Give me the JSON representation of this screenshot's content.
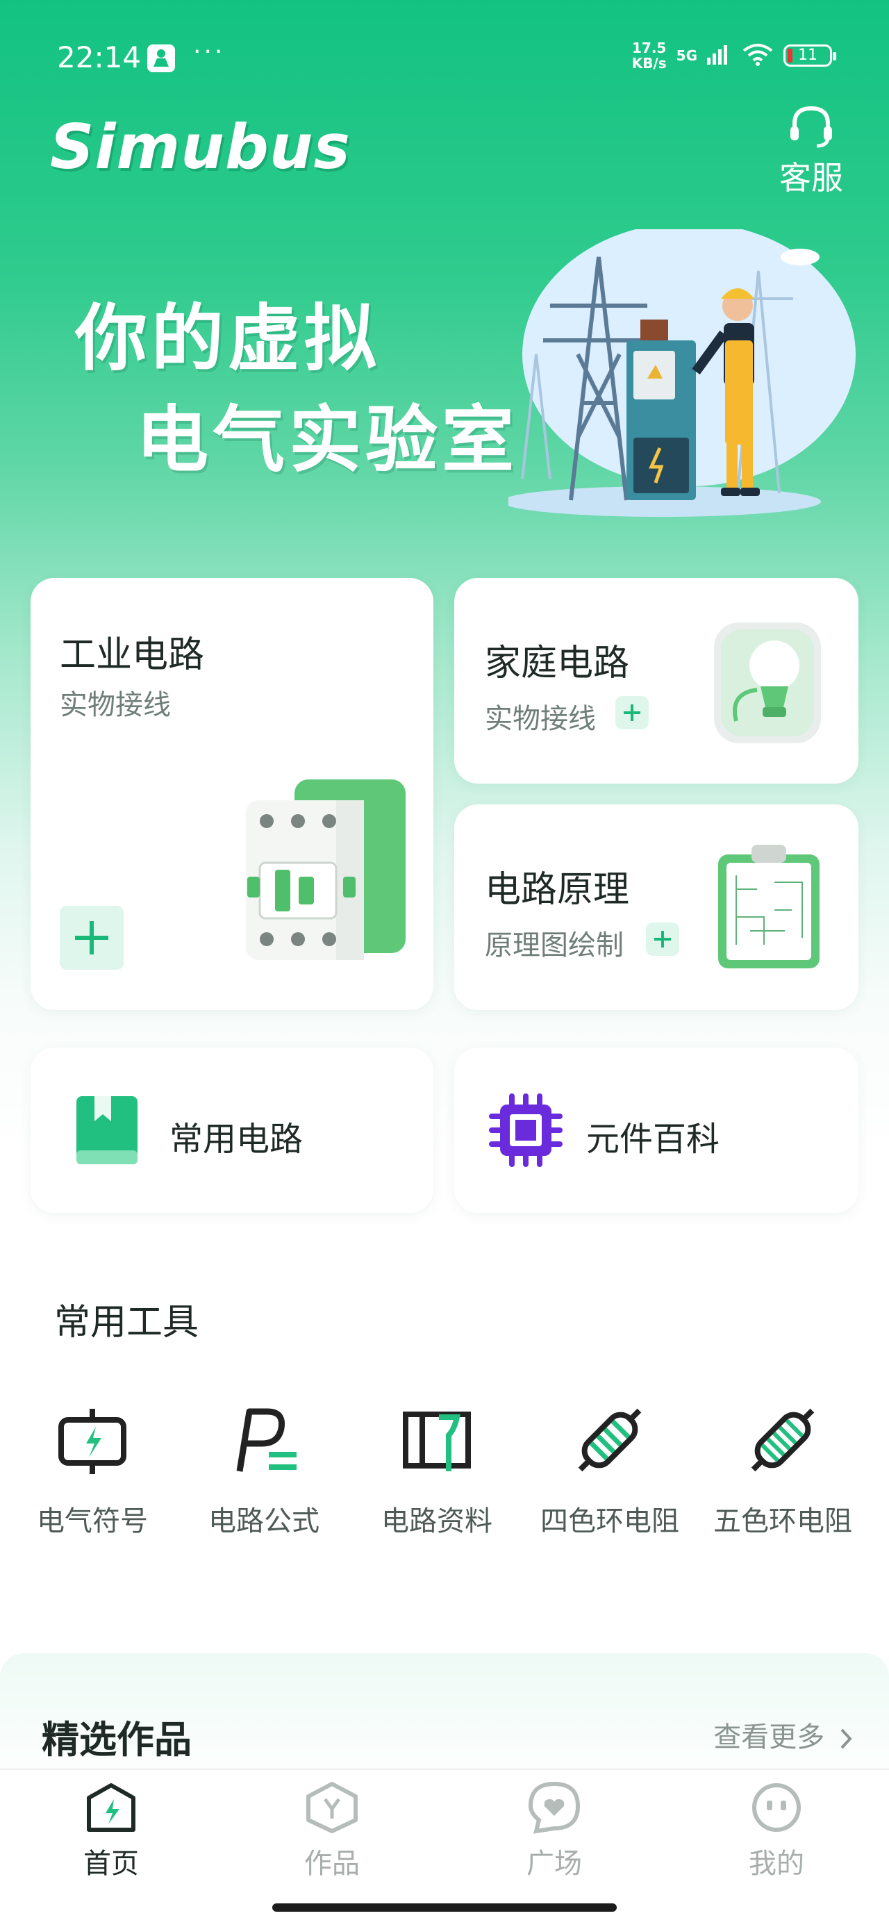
{
  "status_bar": {
    "time": "22:14",
    "dots": "···",
    "speed_top": "17.5",
    "speed_bottom": "KB/s",
    "network": "5G",
    "battery": "11"
  },
  "header": {
    "app_name": "Simubus",
    "service_label": "客服"
  },
  "hero": {
    "slogan_line1": "你的虚拟",
    "slogan_line2": "电气实验室"
  },
  "cards": {
    "industrial": {
      "title": "工业电路",
      "subtitle": "实物接线"
    },
    "home": {
      "title": "家庭电路",
      "subtitle": "实物接线"
    },
    "principle": {
      "title": "电路原理",
      "subtitle": "原理图绘制"
    },
    "common_circuits": {
      "title": "常用电路"
    },
    "components": {
      "title": "元件百科"
    }
  },
  "tools": {
    "title": "常用工具",
    "items": [
      {
        "label": "电气符号",
        "icon": "electric-symbol-icon"
      },
      {
        "label": "电路公式",
        "icon": "formula-icon"
      },
      {
        "label": "电路资料",
        "icon": "book-icon"
      },
      {
        "label": "四色环电阻",
        "icon": "resistor-icon"
      },
      {
        "label": "五色环电阻",
        "icon": "resistor-icon"
      }
    ]
  },
  "featured": {
    "title": "精选作品",
    "more": "查看更多"
  },
  "tabbar": {
    "items": [
      {
        "label": "首页",
        "icon": "home-icon",
        "active": true
      },
      {
        "label": "作品",
        "icon": "works-icon",
        "active": false
      },
      {
        "label": "广场",
        "icon": "square-icon",
        "active": false
      },
      {
        "label": "我的",
        "icon": "profile-icon",
        "active": false
      }
    ]
  },
  "colors": {
    "brand_green": "#13c281",
    "accent_purple": "#6a2bdc",
    "text_dark": "#1f2a27",
    "text_muted": "#6f7e79"
  }
}
